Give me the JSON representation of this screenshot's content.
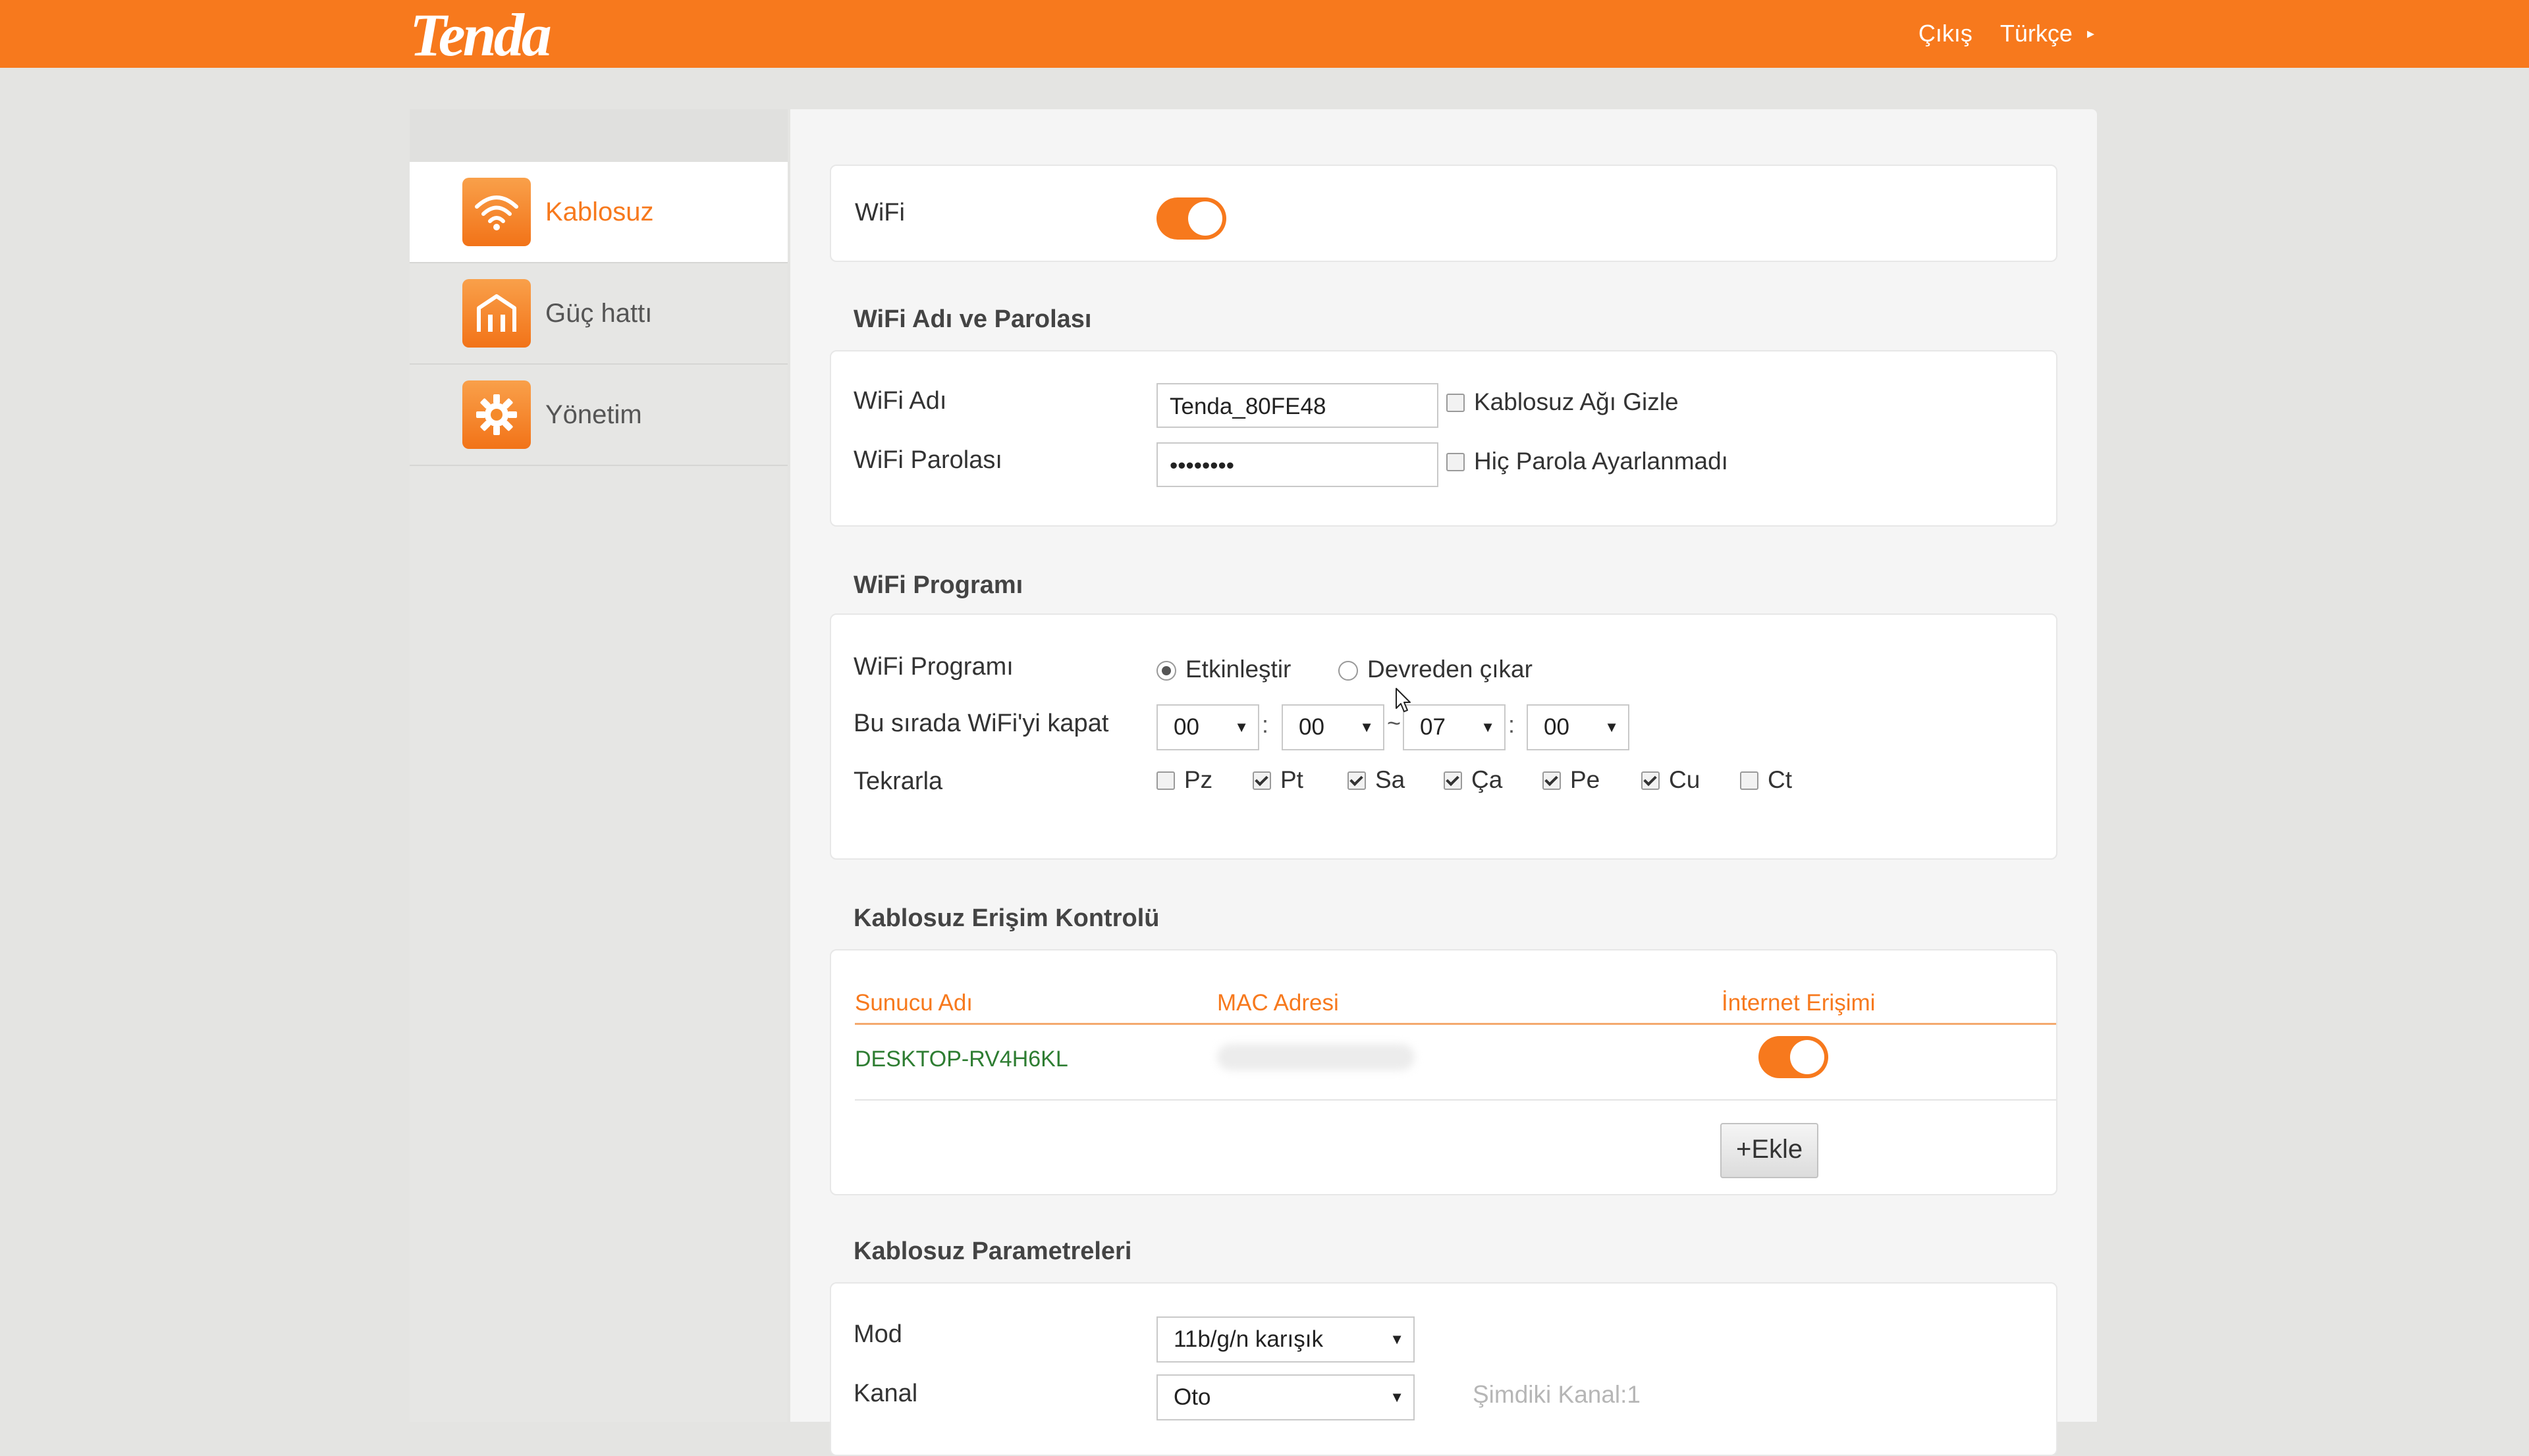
{
  "topbar": {
    "logo": "Tenda",
    "logout": "Çıkış",
    "language": "Türkçe",
    "language_caret": "▸"
  },
  "sidebar": {
    "items": [
      {
        "label": "Kablosuz",
        "icon": "wifi-icon",
        "active": true
      },
      {
        "label": "Güç hattı",
        "icon": "house-icon",
        "active": false
      },
      {
        "label": "Yönetim",
        "icon": "gear-icon",
        "active": false
      }
    ]
  },
  "wifi": {
    "label": "WiFi",
    "enabled": true
  },
  "name_password": {
    "title": "WiFi Adı ve Parolası",
    "ssid_label": "WiFi Adı",
    "ssid_value": "Tenda_80FE48",
    "hide_label": "Kablosuz Ağı Gizle",
    "hide_checked": false,
    "password_label": "WiFi Parolası",
    "password_value": "••••••••",
    "nopass_label": "Hiç Parola Ayarlanmadı",
    "nopass_checked": false
  },
  "schedule": {
    "title": "WiFi Programı",
    "program_label": "WiFi Programı",
    "enable_label": "Etkinleştir",
    "disable_label": "Devreden çıkar",
    "selected": "enable",
    "off_label": "Bu sırada WiFi'yi kapat",
    "start_hour": "00",
    "start_min": "00",
    "separator": ":",
    "tilde": "~",
    "end_hour": "07",
    "end_min": "00",
    "repeat_label": "Tekrarla",
    "days": [
      {
        "label": "Pz",
        "checked": false
      },
      {
        "label": "Pt",
        "checked": true
      },
      {
        "label": "Sa",
        "checked": true
      },
      {
        "label": "Ça",
        "checked": true
      },
      {
        "label": "Pe",
        "checked": true
      },
      {
        "label": "Cu",
        "checked": true
      },
      {
        "label": "Ct",
        "checked": false
      }
    ]
  },
  "access_control": {
    "title": "Kablosuz Erişim Kontrolü",
    "col_host": "Sunucu Adı",
    "col_mac": "MAC Adresi",
    "col_internet": "İnternet Erişimi",
    "rows": [
      {
        "host": "DESKTOP-RV4H6KL",
        "internet": true
      }
    ],
    "add_label": "+Ekle"
  },
  "params": {
    "title": "Kablosuz Parametreleri",
    "mode_label": "Mod",
    "mode_value": "11b/g/n karışık",
    "channel_label": "Kanal",
    "channel_value": "Oto",
    "current_channel": "Şimdiki Kanal:1"
  },
  "colors": {
    "accent": "#f7791d",
    "host_text": "#2e7d32"
  }
}
